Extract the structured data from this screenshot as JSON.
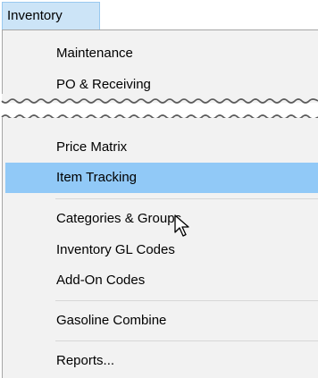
{
  "menubar": {
    "active_menu_label": "Inventory"
  },
  "menu": {
    "top_items": [
      {
        "label": "Maintenance"
      },
      {
        "label": "PO & Receiving"
      }
    ],
    "bottom_items": [
      {
        "label": "Price Matrix"
      },
      {
        "label": "Item Tracking",
        "highlighted": true
      },
      {
        "label": "Categories & Groups"
      },
      {
        "label": "Inventory GL Codes"
      },
      {
        "label": "Add-On Codes"
      },
      {
        "label": "Gasoline Combine"
      },
      {
        "label": "Reports..."
      }
    ]
  },
  "colors": {
    "menu_background": "#f2f2f2",
    "highlight": "#91c9f7",
    "menubar_active": "#cce4f7",
    "separator": "#d7d7d7"
  },
  "icons": {
    "cursor": "mouse-pointer-icon"
  }
}
